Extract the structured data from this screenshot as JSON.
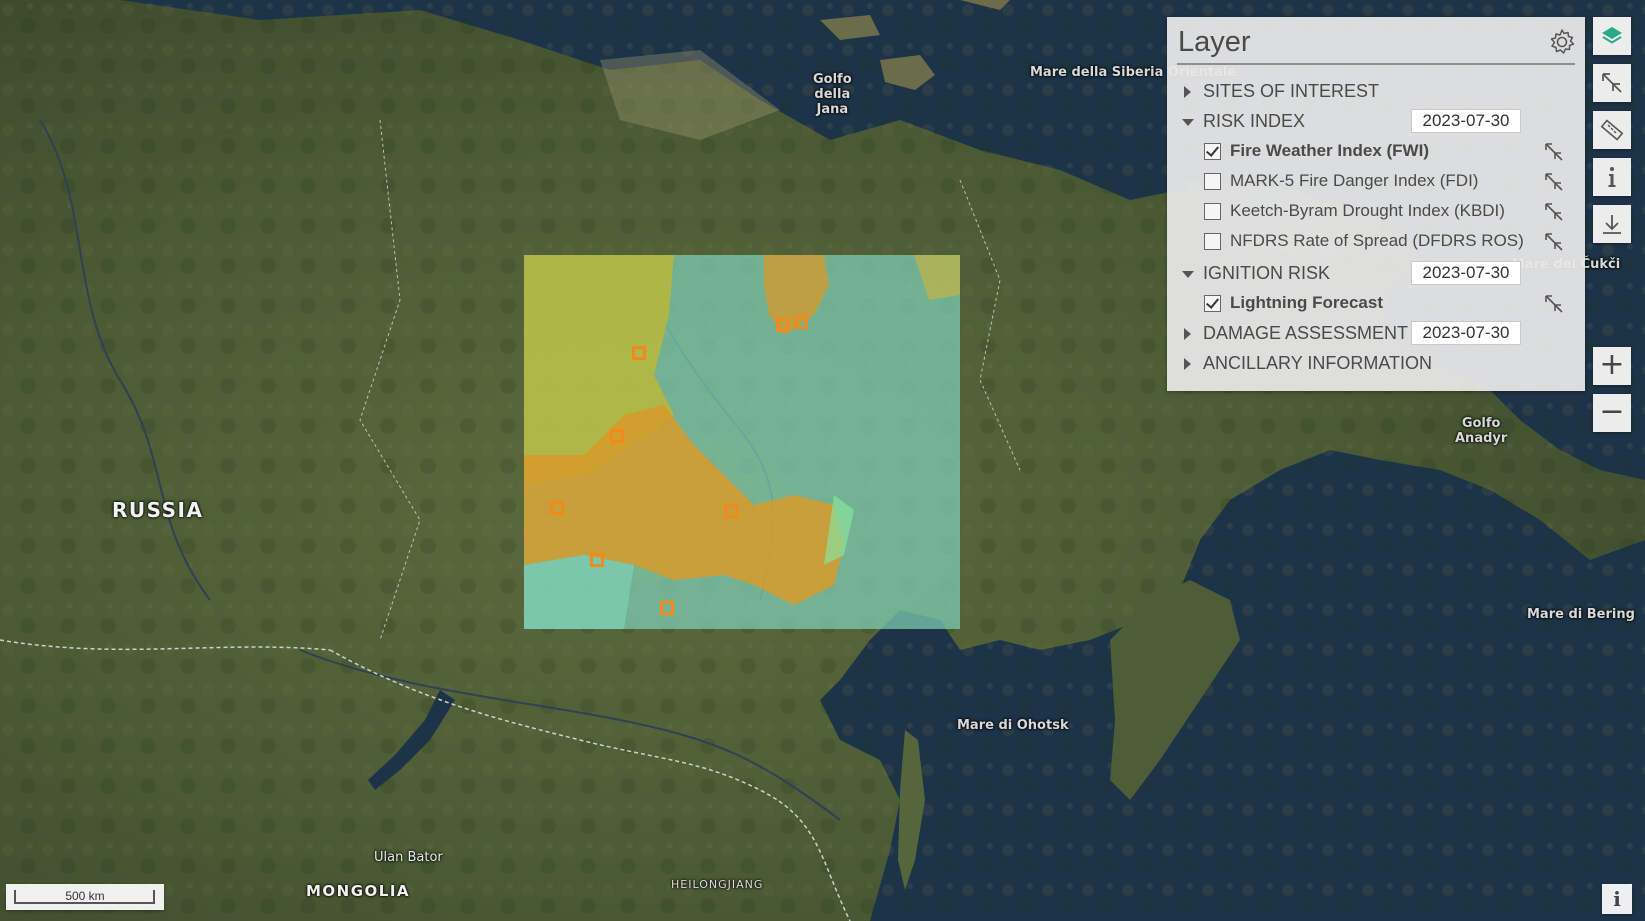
{
  "map": {
    "labels": {
      "russia": "RUSSIA",
      "mongolia": "MONGOLIA",
      "ulan_bator": "Ulan Bator",
      "heilongjiang": "HEILONGJIANG",
      "golfo_jana": "Golfo\ndella\nJana",
      "mare_siberia": "Mare della Siberia Orientale",
      "mare_cukci": "Mare dei Čukči",
      "golfo_anadyr": "Golfo\nAnadyr",
      "mare_bering": "Mare di Bering",
      "mare_ohotsk": "Mare di Ohotsk"
    },
    "site_marker_count": 9
  },
  "layer_panel": {
    "title": "Layer",
    "gear_icon": "gear-icon",
    "sections": {
      "sites_of_interest": {
        "label": "SITES OF INTEREST",
        "expanded": false
      },
      "risk_index": {
        "label": "RISK INDEX",
        "expanded": true,
        "date": "2023-07-30",
        "items": [
          {
            "label": "Fire Weather Index (FWI)",
            "checked": true
          },
          {
            "label": "MARK-5 Fire Danger Index (FDI)",
            "checked": false
          },
          {
            "label": "Keetch-Byram Drought Index (KBDI)",
            "checked": false
          },
          {
            "label": "NFDRS Rate of Spread (DFDRS ROS)",
            "checked": false
          }
        ]
      },
      "ignition_risk": {
        "label": "IGNITION RISK",
        "expanded": true,
        "date": "2023-07-30",
        "items": [
          {
            "label": "Lightning Forecast",
            "checked": true
          }
        ]
      },
      "damage_assessment": {
        "label": "DAMAGE ASSESSMENT",
        "expanded": false,
        "date": "2023-07-30"
      },
      "ancillary_information": {
        "label": "ANCILLARY INFORMATION",
        "expanded": false
      }
    }
  },
  "toolbar": {
    "buttons": [
      "layers-icon",
      "zoom-to-extent-icon",
      "ruler-icon",
      "info-icon",
      "download-icon"
    ],
    "zoom_in": "+",
    "zoom_out": "−"
  },
  "scale_bar": {
    "label": "500 km"
  },
  "info_corner": {
    "label": "i"
  },
  "colors": {
    "sea": "#1d3347",
    "marker": "#f08a1c",
    "risk_high": "#d79b2a",
    "risk_mid": "#b9b73a",
    "risk_low": "#7fd0b6",
    "accent": "#2aa889"
  }
}
